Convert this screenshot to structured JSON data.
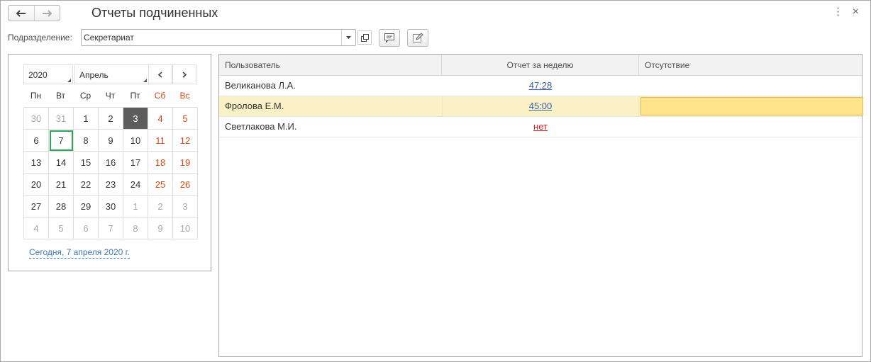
{
  "header": {
    "title": "Отчеты подчиненных",
    "back_icon": "arrow-left-icon",
    "forward_icon": "arrow-right-icon"
  },
  "department": {
    "label": "Подразделение:",
    "value": "Секретариат"
  },
  "calendar": {
    "year": "2020",
    "month": "Апрель",
    "weekdays": [
      "Пн",
      "Вт",
      "Ср",
      "Чт",
      "Пт",
      "Сб",
      "Вс"
    ],
    "days": [
      [
        "30",
        "31",
        "1",
        "2",
        "3",
        "4",
        "5"
      ],
      [
        "6",
        "7",
        "8",
        "9",
        "10",
        "11",
        "12"
      ],
      [
        "13",
        "14",
        "15",
        "16",
        "17",
        "18",
        "19"
      ],
      [
        "20",
        "21",
        "22",
        "23",
        "24",
        "25",
        "26"
      ],
      [
        "27",
        "28",
        "29",
        "30",
        "1",
        "2",
        "3"
      ],
      [
        "4",
        "5",
        "6",
        "7",
        "8",
        "9",
        "10"
      ]
    ],
    "selected_day": "3",
    "today_day": "7",
    "today_link": "Сегодня, 7 апреля 2020 г."
  },
  "table": {
    "columns": [
      "Пользователь",
      "Отчет за неделю",
      "Отсутствие"
    ],
    "rows": [
      {
        "user": "Великанова Л.А.",
        "report": "47:28",
        "absence": ""
      },
      {
        "user": "Фролова Е.М.",
        "report": "45:00",
        "absence": ""
      },
      {
        "user": "Светлакова М.И.",
        "report": "нет",
        "absence": ""
      }
    ]
  },
  "colors": {
    "weekend": "#d44a17",
    "selected_row": "#fbf1c6",
    "focused_cell": "#ffe38a",
    "today_outline": "#2ea65a",
    "link": "#3c5fa5",
    "missing_report": "#c81e1e"
  }
}
